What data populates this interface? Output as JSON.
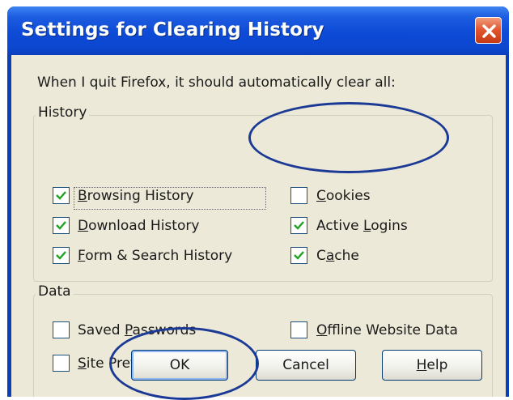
{
  "dialog": {
    "title": "Settings for Clearing History",
    "instruction": "When I quit Firefox, it should automatically clear all:"
  },
  "history_group": {
    "title": "History",
    "items": [
      {
        "prefix": "",
        "accel": "B",
        "rest": "rowsing History",
        "checked": true
      },
      {
        "prefix": "",
        "accel": "D",
        "rest": "ownload History",
        "checked": true
      },
      {
        "prefix": "",
        "accel": "F",
        "rest": "orm & Search History",
        "checked": true
      },
      {
        "prefix": "",
        "accel": "C",
        "rest": "ookies",
        "checked": false
      },
      {
        "prefix": "Active ",
        "accel": "L",
        "rest": "ogins",
        "checked": true
      },
      {
        "prefix": "C",
        "accel": "a",
        "rest": "che",
        "checked": true
      }
    ]
  },
  "data_group": {
    "title": "Data",
    "items": [
      {
        "prefix": "Saved ",
        "accel": "P",
        "rest": "asswords",
        "checked": false
      },
      {
        "prefix": "",
        "accel": "S",
        "rest": "ite Preferences",
        "checked": false
      },
      {
        "prefix": "",
        "accel": "O",
        "rest": "ffline Website Data",
        "checked": false
      }
    ]
  },
  "buttons": {
    "ok": "OK",
    "cancel": "Cancel",
    "help_accel": "H",
    "help_rest": "elp"
  },
  "colors": {
    "titlebar": "#0c47d0",
    "client": "#ece9d8",
    "close": "#e0542d",
    "annotation": "#1b3a95",
    "check": "#21a121"
  }
}
